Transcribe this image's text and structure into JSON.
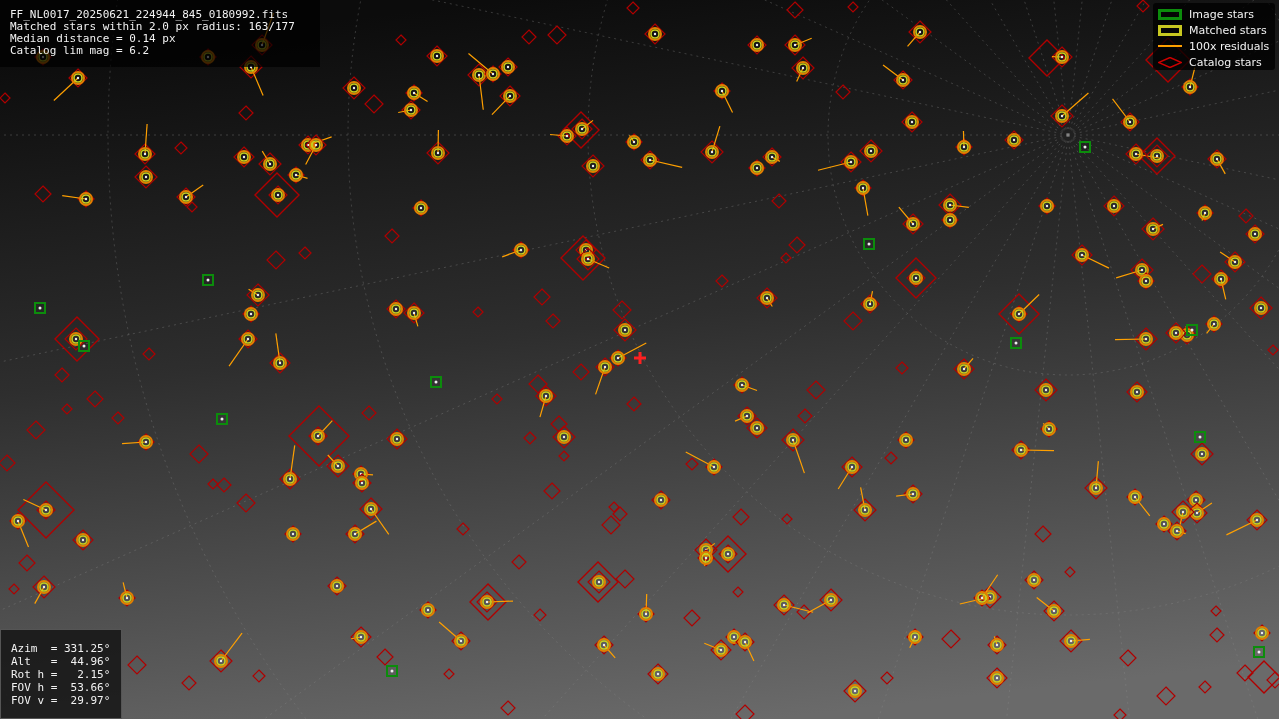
{
  "header": {
    "lines": [
      "FF_NL0017_20250621_224944_845_0180992.fits",
      "Matched stars within 2.0 px radius: 163/177",
      "Median distance = 0.14 px",
      "Catalog lim mag = 6.2"
    ]
  },
  "legend": [
    {
      "label": "Image stars",
      "kind": "rect",
      "color": "#0c8c0c"
    },
    {
      "label": "Matched stars",
      "kind": "rect",
      "color": "#c8c820"
    },
    {
      "label": "100x residuals",
      "kind": "line",
      "color": "#ffa000"
    },
    {
      "label": "Catalog stars",
      "kind": "diamond",
      "color": "#cc0000"
    }
  ],
  "pointing": {
    "lines": [
      "Azim  = 331.25°",
      "Alt   =  44.96°",
      "Rot h =   2.15°",
      "FOV h =  53.66°",
      "FOV v =  29.97°"
    ]
  }
}
